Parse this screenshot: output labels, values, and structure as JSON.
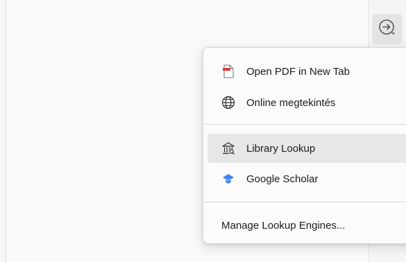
{
  "toolbar": {
    "lookup_button_icon": "arrow-right-circle-icon"
  },
  "menu": {
    "items": [
      {
        "label": "Open PDF in New Tab",
        "icon": "pdf-file-icon",
        "accent": "#e03b3b"
      },
      {
        "label": "Online megtekintés",
        "icon": "globe-icon",
        "accent": "#2b2b2b"
      }
    ],
    "engines": [
      {
        "label": "Library Lookup",
        "icon": "library-icon",
        "accent": "#2b2b2b",
        "highlighted": true
      },
      {
        "label": "Google Scholar",
        "icon": "google-scholar-icon",
        "accent": "#4285f4",
        "highlighted": false
      }
    ],
    "manage_label": "Manage Lookup Engines..."
  },
  "colors": {
    "menu_background": "#fbfbfb",
    "highlight_background": "#e7e7e7",
    "scholar_blue": "#4285f4",
    "pdf_red": "#e03b3b"
  }
}
